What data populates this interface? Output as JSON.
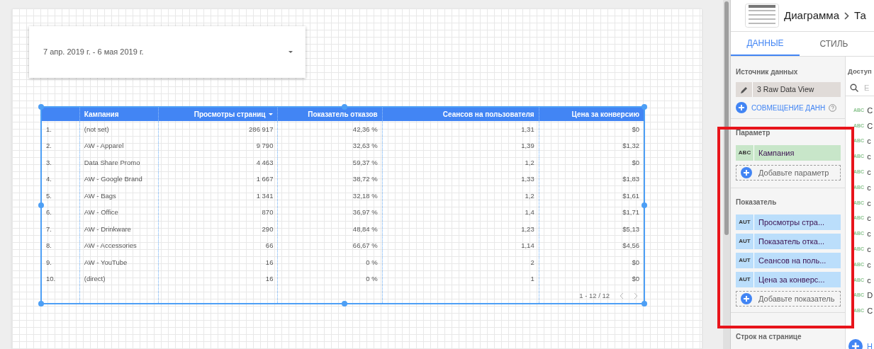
{
  "date_range": {
    "value": "7 апр. 2019 г. - 6 мая 2019 г."
  },
  "table": {
    "columns": [
      {
        "sorted": false
      },
      {
        "label": "Кампания",
        "sorted": false
      },
      {
        "label": "Просмотры страниц",
        "sorted": true
      },
      {
        "label": "Показатель отказов",
        "sorted": false
      },
      {
        "label": "Сеансов на пользователя",
        "sorted": false
      },
      {
        "label": "Цена за конверсию",
        "sorted": false
      }
    ],
    "rows": [
      [
        "1.",
        "(not set)",
        "286 917",
        "42,36 %",
        "1,31",
        "$0"
      ],
      [
        "2.",
        "AW - Apparel",
        "9 790",
        "32,63 %",
        "1,39",
        "$1,32"
      ],
      [
        "3.",
        "Data Share Promo",
        "4 463",
        "59,37 %",
        "1,2",
        "$0"
      ],
      [
        "4.",
        "AW - Google Brand",
        "1 667",
        "38,72 %",
        "1,33",
        "$1,83"
      ],
      [
        "5.",
        "AW - Bags",
        "1 341",
        "32,18 %",
        "1,2",
        "$1,61"
      ],
      [
        "6.",
        "AW - Office",
        "870",
        "36,97 %",
        "1,4",
        "$1,71"
      ],
      [
        "7.",
        "AW - Drinkware",
        "290",
        "48,84 %",
        "1,23",
        "$5,13"
      ],
      [
        "8.",
        "AW - Accessories",
        "66",
        "66,67 %",
        "1,14",
        "$4,56"
      ],
      [
        "9.",
        "AW - YouTube",
        "16",
        "0 %",
        "2",
        "$0"
      ],
      [
        "10.",
        "(direct)",
        "16",
        "0 %",
        "1",
        "$0"
      ]
    ],
    "pagination": "1 - 12 / 12"
  },
  "panel": {
    "breadcrumb": [
      "Диаграмма",
      "Та"
    ],
    "tabs": [
      {
        "label": "ДАННЫЕ",
        "selected": true
      },
      {
        "label": "СТИЛЬ",
        "selected": false
      }
    ],
    "data_source": {
      "title": "Источник данных",
      "value": "3 Raw Data View",
      "blend": "СОВМЕЩЕНИЕ ДАНН"
    },
    "dimension": {
      "title": "Параметр",
      "items": [
        {
          "type": "ABC",
          "name": "Кампания"
        }
      ],
      "add": "Добавьте параметр"
    },
    "metric": {
      "title": "Показатель",
      "items": [
        {
          "type": "AUT",
          "name": "Просмотры стра..."
        },
        {
          "type": "AUT",
          "name": "Показатель отка..."
        },
        {
          "type": "AUT",
          "name": "Сеансов на поль..."
        },
        {
          "type": "AUT",
          "name": "Цена за конверс..."
        }
      ],
      "add": "Добавьте показатель"
    },
    "rows_per_page": {
      "title": "Строк на странице"
    },
    "available": {
      "title": "Доступ",
      "search_placeholder": "E",
      "fields": [
        {
          "type": "ABC",
          "name": "C"
        },
        {
          "type": "ABC",
          "name": "C"
        },
        {
          "type": "ABC",
          "name": "c"
        },
        {
          "type": "ABC",
          "name": "c"
        },
        {
          "type": "ABC",
          "name": "c"
        },
        {
          "type": "ABC",
          "name": "c"
        },
        {
          "type": "ABC",
          "name": "c"
        },
        {
          "type": "ABC",
          "name": "c"
        },
        {
          "type": "ABC",
          "name": "c"
        },
        {
          "type": "ABC",
          "name": "c"
        },
        {
          "type": "ABC",
          "name": "c"
        },
        {
          "type": "ABC",
          "name": "c"
        },
        {
          "type": "ABC",
          "name": "D"
        },
        {
          "type": "ABC",
          "name": "C"
        }
      ],
      "add": "Н"
    }
  }
}
